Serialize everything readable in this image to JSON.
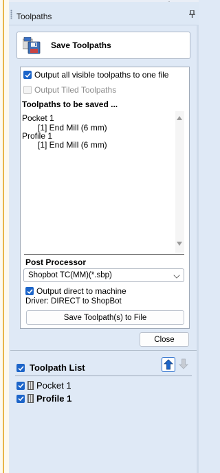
{
  "panel": {
    "title": "Toolpaths"
  },
  "save_header": {
    "title": "Save Toolpaths"
  },
  "options": {
    "output_all_visible": {
      "label": "Output all visible toolpaths to one file",
      "checked": true
    },
    "output_tiled": {
      "label": "Output Tiled Toolpaths",
      "checked": false,
      "disabled": true
    }
  },
  "toolpaths_to_save": {
    "heading": "Toolpaths to be saved ...",
    "lines": [
      "Pocket 1",
      "[1] End Mill (6 mm)",
      "Profile 1",
      "[1] End Mill (6 mm)"
    ]
  },
  "post_processor": {
    "heading": "Post Processor",
    "selected": "Shopbot TC(MM)(*.sbp)",
    "output_direct": {
      "label": "Output direct to machine",
      "checked": true
    },
    "driver": "Driver: DIRECT to ShopBot",
    "save_button": "Save Toolpath(s) to File"
  },
  "close_button": "Close",
  "toolpath_list": {
    "label": "Toolpath List",
    "checked": true,
    "items": [
      {
        "name": "Pocket 1",
        "checked": true,
        "bold": false
      },
      {
        "name": "Profile 1",
        "checked": true,
        "bold": true
      }
    ]
  },
  "colors": {
    "accent": "#1d65c9",
    "panel_bg": "#dfe9f6"
  }
}
